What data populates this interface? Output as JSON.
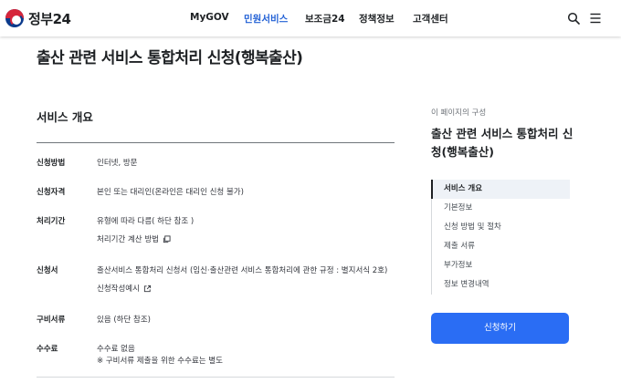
{
  "header": {
    "logo_text": "정부24",
    "nav": [
      {
        "label": "MyGOV",
        "active": false
      },
      {
        "label": "민원서비스",
        "active": true
      },
      {
        "label": "보조금24",
        "active": false
      },
      {
        "label": "정책정보",
        "active": false
      },
      {
        "label": "고객센터",
        "active": false
      }
    ],
    "icons": [
      "search-icon",
      "menu-icon"
    ],
    "accent_color": "#2563d6"
  },
  "page_title": "출산 관련 서비스 통합처리 신청(행복출산)",
  "main": {
    "section_title": "서비스 개요",
    "rows": [
      {
        "label": "신청방법",
        "lines": [
          "인터넷, 방문"
        ]
      },
      {
        "label": "신청자격",
        "lines": [
          "본인 또는 대리인(온라인은 대리인 신청 불가)"
        ]
      },
      {
        "label": "처리기간",
        "lines": [
          "유형에 따라 다름( 하단 참조 )"
        ],
        "link": "처리기간 계산 방법"
      },
      {
        "label": "신청서",
        "lines": [
          "출산서비스 통합처리 신청서 (임신·출산관련 서비스 통합처리에 관한 규정 : 별지서식 2호)"
        ],
        "link": "신청작성예시"
      },
      {
        "label": "구비서류",
        "lines": [
          "있음 (하단 참조)"
        ]
      },
      {
        "label": "수수료",
        "lines": [
          "수수료 없음",
          "※ 구비서류 제출을 위한 수수료는 별도"
        ]
      }
    ]
  },
  "aside": {
    "caption": "이 페이지의 구성",
    "title": "출산 관련 서비스 통합처리 신청(행복출산)",
    "toc": [
      {
        "label": "서비스 개요",
        "active": true
      },
      {
        "label": "기본정보",
        "active": false
      },
      {
        "label": "신청 방법 및 절차",
        "active": false
      },
      {
        "label": "제출 서류",
        "active": false
      },
      {
        "label": "부가정보",
        "active": false
      },
      {
        "label": "정보 변경내역",
        "active": false
      }
    ],
    "apply_label": "신청하기",
    "apply_color": "#2a6df4"
  }
}
